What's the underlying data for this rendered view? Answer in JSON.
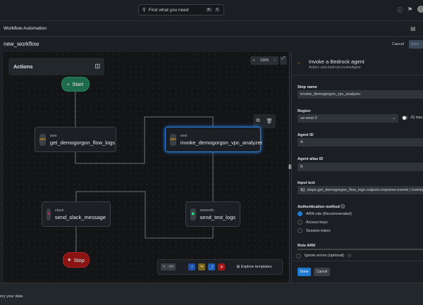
{
  "topbar": {
    "search_placeholder": "Find what you need",
    "shortcut_mod": "⌘",
    "shortcut_key": "K",
    "avatar": "2"
  },
  "app": {
    "title": "Workflow Automation"
  },
  "workflow": {
    "name": "new_workflow",
    "cancel": "Cancel",
    "save": "Save"
  },
  "canvas": {
    "actions_label": "Actions",
    "zoom_level": "128%",
    "start": "Start",
    "stop": "Stop",
    "nodes": [
      {
        "provider": "aws",
        "name": "get_demogorgon_flow_logs"
      },
      {
        "provider": "aws",
        "name": "invoke_demogorgon_vpc_analyzer"
      },
      {
        "provider": "slack",
        "name": "send_slack_message"
      },
      {
        "provider": "newrelic",
        "name": "send_test_logs"
      }
    ],
    "toolbar": {
      "explore": "Explore templates",
      "code": "</>"
    }
  },
  "panel": {
    "title": "Invoke a Bedrock agent",
    "subtitle": "Action: aws.bedrock.invokeAgent",
    "step_name_label": "Step name",
    "step_name": "invoke_demogorgon_vpc_analyzer",
    "region_label": "Region",
    "region": "us-west-2",
    "jq_label": "JQ inpu",
    "agent_id_label": "Agent ID",
    "agent_id": "A",
    "agent_alias_label": "Agent alias ID",
    "agent_alias": "B",
    "input_label": "Input text",
    "input": "${{ .steps.get_demogorgon_flow_logs.outputs.response.events | tostring",
    "auth_label": "Authentication method",
    "auth_options": [
      "ARN role (Recommended)",
      "Access keys",
      "Session token"
    ],
    "auth_selected": 0,
    "role_arn_label": "Role ARN",
    "ignore_errors": "Ignore errors (optional)",
    "done": "Done",
    "cancel": "Cancel"
  },
  "footer": {
    "text": "ery your data"
  },
  "colors": {
    "accent": "#1f7ad1",
    "start": "#1d6b4c",
    "stop": "#8a1414",
    "selected": "#2a7fe0"
  }
}
